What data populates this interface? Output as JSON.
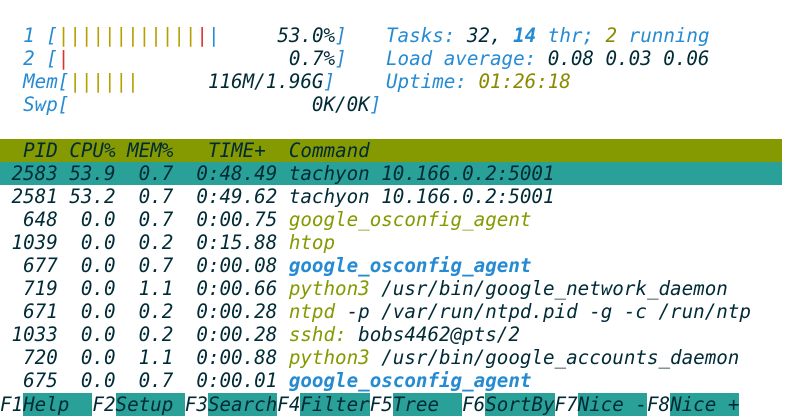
{
  "meters": {
    "cpu1": {
      "label": "1",
      "bar": "||||||||||||",
      "bar_red": "|",
      "bar_blue": "|",
      "value": "53.0%"
    },
    "cpu2": {
      "label": "2",
      "bar_red": "|",
      "value": "0.7%"
    },
    "mem": {
      "label": "Mem",
      "bar": "||||||",
      "value": "116M/1.96G"
    },
    "swp": {
      "label": "Swp",
      "value": "0K/0K"
    }
  },
  "stats": {
    "tasks_label": "Tasks:",
    "tasks": "32,",
    "threads": "14",
    "threads_label": "thr;",
    "running": "2",
    "running_label": "running",
    "load_label": "Load average:",
    "load": "0.08 0.03 0.06",
    "uptime_label": "Uptime:",
    "uptime": "01:26:18"
  },
  "table": {
    "headers": [
      "PID",
      "CPU%",
      "MEM%",
      "TIME+",
      "Command"
    ],
    "rows": [
      {
        "pid": "2583",
        "cpu": "53.9",
        "mem": "0.7",
        "time": "0:48.49",
        "cmd": "tachyon",
        "args": "10.166.0.2:5001",
        "style": "selected"
      },
      {
        "pid": "2581",
        "cpu": "53.2",
        "mem": "0.7",
        "time": "0:49.62",
        "cmd": "tachyon",
        "args": "10.166.0.2:5001",
        "style": "normal"
      },
      {
        "pid": "648",
        "cpu": "0.0",
        "mem": "0.7",
        "time": "0:00.75",
        "cmd": "google_osconfig_agent",
        "args": "",
        "style": "thread"
      },
      {
        "pid": "1039",
        "cpu": "0.0",
        "mem": "0.2",
        "time": "0:15.88",
        "cmd": "htop",
        "args": "",
        "style": "thread"
      },
      {
        "pid": "677",
        "cpu": "0.0",
        "mem": "0.7",
        "time": "0:00.08",
        "cmd": "google_osconfig_agent",
        "args": "",
        "style": "bold"
      },
      {
        "pid": "719",
        "cpu": "0.0",
        "mem": "1.1",
        "time": "0:00.66",
        "cmd": "python3",
        "args": "/usr/bin/google_network_daemon",
        "style": "thread"
      },
      {
        "pid": "671",
        "cpu": "0.0",
        "mem": "0.2",
        "time": "0:00.28",
        "cmd": "ntpd",
        "args": "-p /var/run/ntpd.pid -g -c /run/ntp",
        "style": "thread"
      },
      {
        "pid": "1033",
        "cpu": "0.0",
        "mem": "0.2",
        "time": "0:00.28",
        "cmd": "sshd:",
        "args": "bobs4462@pts/2",
        "style": "thread"
      },
      {
        "pid": "720",
        "cpu": "0.0",
        "mem": "1.1",
        "time": "0:00.88",
        "cmd": "python3",
        "args": "/usr/bin/google_accounts_daemon",
        "style": "thread"
      },
      {
        "pid": "675",
        "cpu": "0.0",
        "mem": "0.7",
        "time": "0:00.01",
        "cmd": "google_osconfig_agent",
        "args": "",
        "style": "bold"
      }
    ]
  },
  "fkeys": [
    {
      "key": "F1",
      "label": "Help  "
    },
    {
      "key": "F2",
      "label": "Setup "
    },
    {
      "key": "F3",
      "label": "Search"
    },
    {
      "key": "F4",
      "label": "Filter"
    },
    {
      "key": "F5",
      "label": "Tree  "
    },
    {
      "key": "F6",
      "label": "SortBy"
    },
    {
      "key": "F7",
      "label": "Nice -"
    },
    {
      "key": "F8",
      "label": "Nice +"
    }
  ]
}
